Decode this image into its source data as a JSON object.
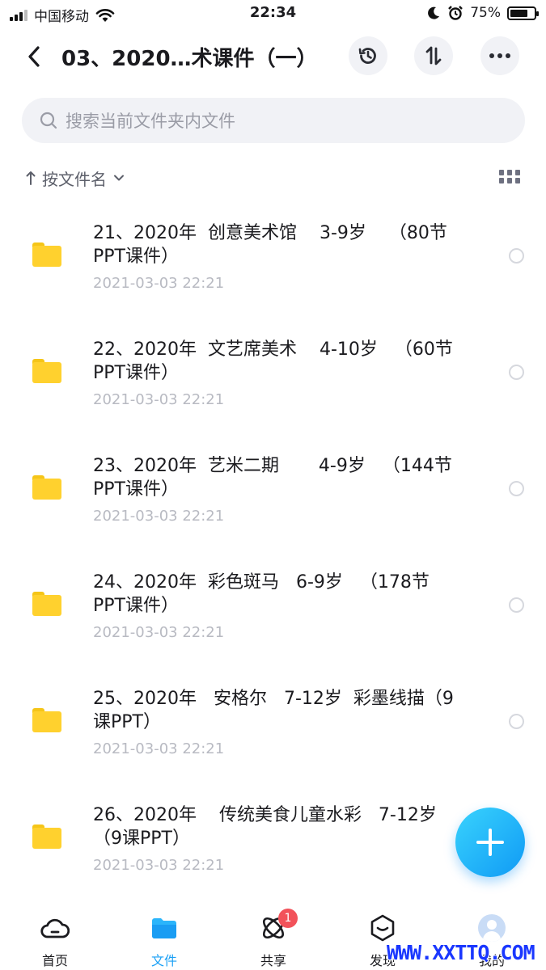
{
  "status_bar": {
    "carrier": "中国移动",
    "time": "22:34",
    "battery_percent": "75%",
    "battery_level": 0.75,
    "icons": [
      "signal-icon",
      "wifi-icon",
      "moon-icon",
      "alarm-icon",
      "battery-icon"
    ]
  },
  "header": {
    "title": "03、2020…术课件（一）",
    "icons": [
      "back-icon",
      "history-icon",
      "sort-icon",
      "more-icon"
    ]
  },
  "search": {
    "placeholder": "搜索当前文件夹内文件"
  },
  "sort": {
    "label": "按文件名",
    "direction": "ascending"
  },
  "files": [
    {
      "name": "21、2020年  创意美术馆    3-9岁    （80节PPT课件）",
      "date": "2021-03-03 22:21"
    },
    {
      "name": "22、2020年  文艺席美术    4-10岁   （60节PPT课件）",
      "date": "2021-03-03 22:21"
    },
    {
      "name": "23、2020年  艺米二期       4-9岁   （144节PPT课件）",
      "date": "2021-03-03 22:21"
    },
    {
      "name": "24、2020年  彩色斑马   6-9岁   （178节PPT课件）",
      "date": "2021-03-03 22:21"
    },
    {
      "name": "25、2020年   安格尔   7-12岁  彩墨线描（9课PPT）",
      "date": "2021-03-03 22:21"
    },
    {
      "name": "26、2020年    传统美食儿童水彩   7-12岁  （9课PPT）",
      "date": "2021-03-03 22:21"
    }
  ],
  "bottom_nav": [
    {
      "label": "首页",
      "icon": "cloud-icon",
      "active": false
    },
    {
      "label": "文件",
      "icon": "folder-icon",
      "active": true
    },
    {
      "label": "共享",
      "icon": "share-icon",
      "active": false,
      "badge": "1"
    },
    {
      "label": "发现",
      "icon": "discover-icon",
      "active": false
    },
    {
      "label": "我的",
      "icon": "avatar",
      "active": false
    }
  ],
  "watermark": "WWW.XXTTQ.COM",
  "colors": {
    "accent": "#1aa0f5",
    "folder": "#ffd12e",
    "badge": "#f2525a"
  }
}
